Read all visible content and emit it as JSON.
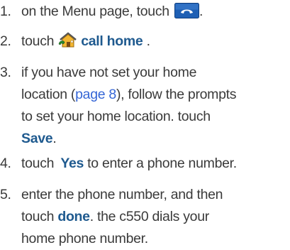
{
  "steps": [
    {
      "number": "1.",
      "text_before": "on the Menu page, touch",
      "button_icon": "phone-handset-button-icon",
      "text_after": "."
    },
    {
      "number": "2.",
      "text_before": "touch",
      "icon": "call-home-icon",
      "highlight": "call home",
      "text_after": " ."
    },
    {
      "number": "3.",
      "line1": "if you have not set your home",
      "line2_before": "location (",
      "link": "page 8",
      "line2_after": "), follow the prompts",
      "line3": "to set your home location. touch",
      "highlight": "Save",
      "text_after": "."
    },
    {
      "number": "4.",
      "text_before": "touch ",
      "highlight": "Yes",
      "text_after": " to enter a phone number."
    },
    {
      "number": "5.",
      "line1": "enter the phone number, and then",
      "line2_before": "touch ",
      "highlight": "done",
      "line2_after": ". the c550 dials your",
      "line3": "home phone number."
    }
  ],
  "colors": {
    "text": "#3a3a3a",
    "highlight": "#1f5a8f",
    "link": "#3566d6",
    "button_blue": "#1e5fb4"
  }
}
